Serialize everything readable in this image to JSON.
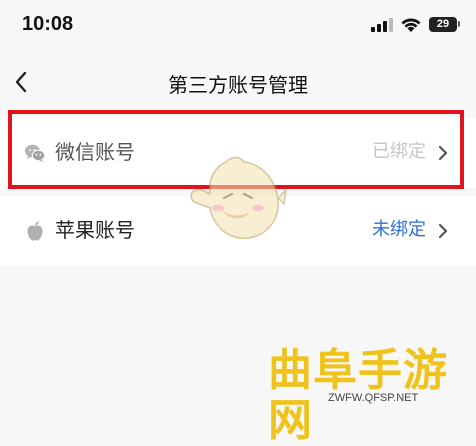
{
  "status_bar": {
    "time": "10:08",
    "battery_level": "29",
    "icons": [
      "cellular-signal-icon",
      "wifi-icon",
      "battery-icon"
    ]
  },
  "nav": {
    "back_icon": "chevron-left-icon",
    "title": "第三方账号管理"
  },
  "accounts": [
    {
      "icon": "wechat-icon",
      "label": "微信账号",
      "status": "已绑定",
      "status_color": "#c6c6c6",
      "chevron_icon": "chevron-right-icon"
    },
    {
      "icon": "apple-icon",
      "label": "苹果账号",
      "status": "未绑定",
      "status_color": "#2f6fd6",
      "chevron_icon": "chevron-right-icon"
    }
  ],
  "annotation": {
    "highlight_color": "#e0141c"
  },
  "watermark": {
    "brand": "曲阜手游网",
    "url": "ZWFW.QFSP.NET",
    "brand_color": "#f0c31c"
  }
}
